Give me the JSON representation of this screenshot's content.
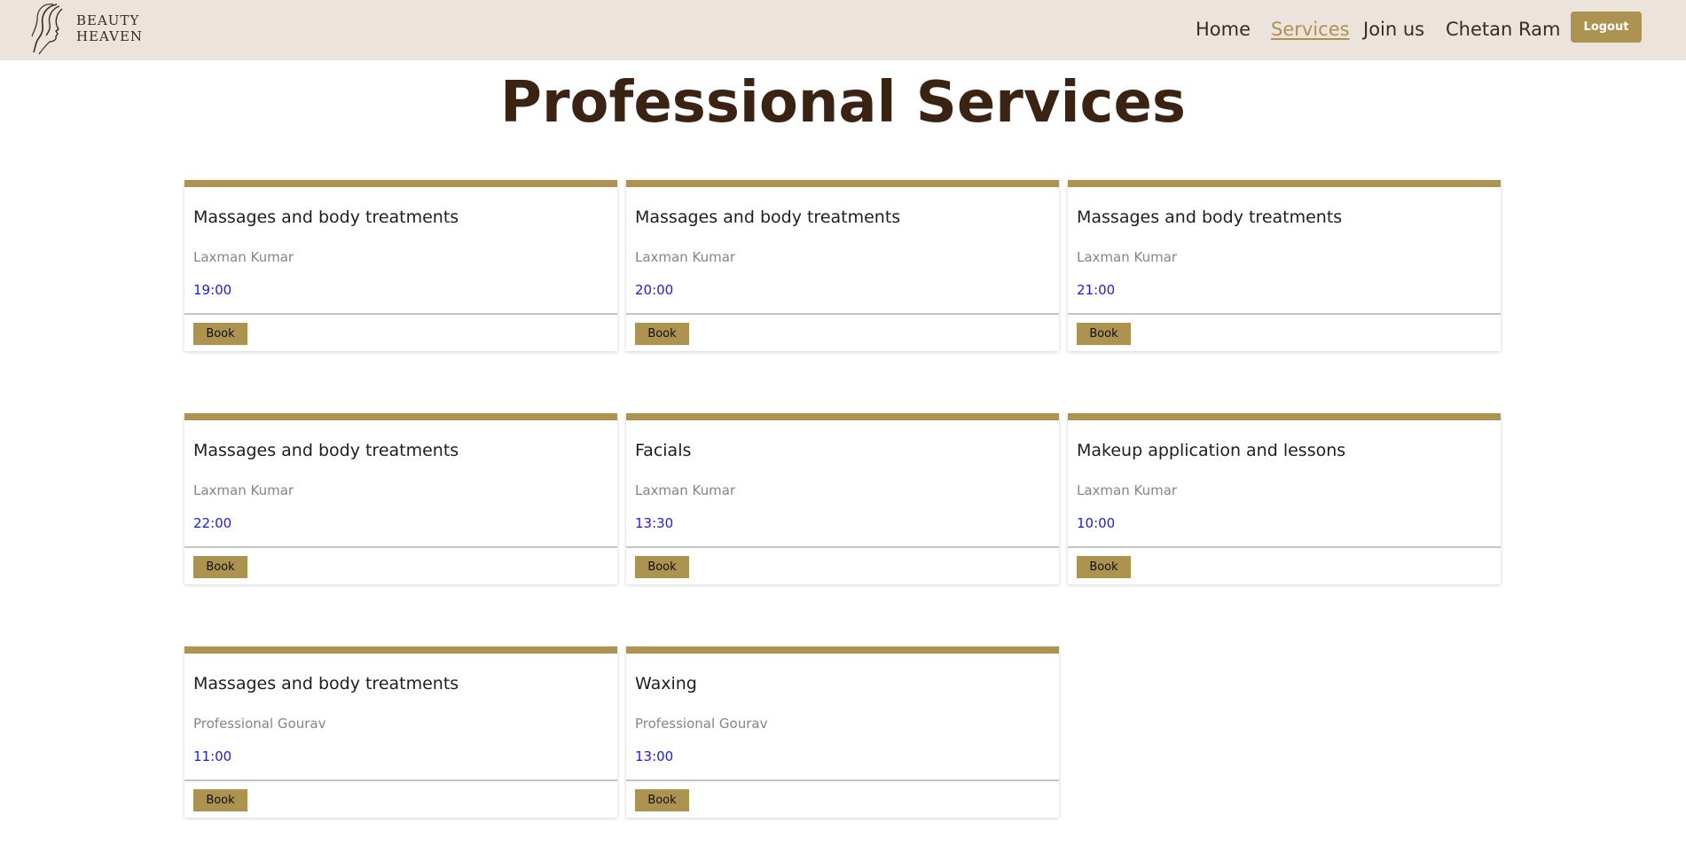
{
  "brand": {
    "line1": "BEAUTY",
    "line2": "HEAVEN",
    "logo_icon": "woman-silhouette-icon"
  },
  "nav": {
    "links": [
      {
        "label": "Home"
      },
      {
        "label": "Services",
        "active": true
      },
      {
        "label": "Join us"
      },
      {
        "label": "Chetan Ram"
      }
    ],
    "logout_label": "Logout"
  },
  "page": {
    "title": "Professional Services"
  },
  "services": [
    {
      "service": "Massages and body treatments",
      "professional": "Laxman Kumar",
      "time": "19:00",
      "book_label": "Book"
    },
    {
      "service": "Massages and body treatments",
      "professional": "Laxman Kumar",
      "time": "20:00",
      "book_label": "Book"
    },
    {
      "service": "Massages and body treatments",
      "professional": "Laxman Kumar",
      "time": "21:00",
      "book_label": "Book"
    },
    {
      "service": "Massages and body treatments",
      "professional": "Laxman Kumar",
      "time": "22:00",
      "book_label": "Book"
    },
    {
      "service": "Facials",
      "professional": "Laxman Kumar",
      "time": "13:30",
      "book_label": "Book"
    },
    {
      "service": "Makeup application and lessons",
      "professional": "Laxman Kumar",
      "time": "10:00",
      "book_label": "Book"
    },
    {
      "service": "Massages and body treatments",
      "professional": "Professional Gourav",
      "time": "11:00",
      "book_label": "Book"
    },
    {
      "service": "Waxing",
      "professional": "Professional Gourav",
      "time": "13:00",
      "book_label": "Book"
    }
  ],
  "colors": {
    "navbar_bg": "#ebe3dc",
    "accent": "#ad9350",
    "title": "#3b2314",
    "time_text": "#1a1aff",
    "muted_text": "#858585"
  }
}
